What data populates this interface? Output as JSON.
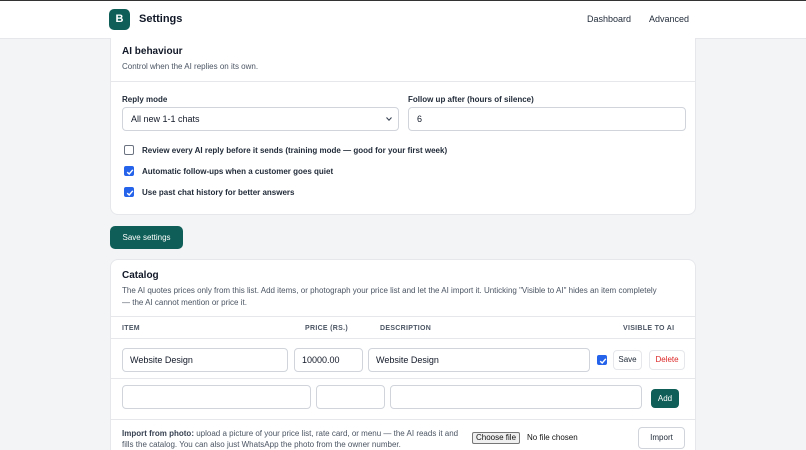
{
  "header": {
    "logo_letter": "B",
    "title": "Settings",
    "nav": {
      "dashboard": "Dashboard",
      "advanced": "Advanced"
    }
  },
  "ai_behaviour": {
    "title": "AI behaviour",
    "subtitle": "Control when the AI replies on its own.",
    "reply_mode": {
      "label": "Reply mode",
      "value": "All new 1-1 chats"
    },
    "follow_up": {
      "label": "Follow up after (hours of silence)",
      "value": "6"
    },
    "options": [
      {
        "label": "Review every AI reply before it sends (training mode — good for your first week)",
        "checked": false
      },
      {
        "label": "Automatic follow-ups when a customer goes quiet",
        "checked": true
      },
      {
        "label": "Use past chat history for better answers",
        "checked": true
      }
    ]
  },
  "save_settings_label": "Save settings",
  "catalog": {
    "title": "Catalog",
    "description": "The AI quotes prices only from this list. Add items, or photograph your price list and let the AI import it. Unticking \"Visible to AI\" hides an item completely — the AI cannot mention or price it.",
    "columns": {
      "item": "ITEM",
      "price": "PRICE (RS.)",
      "description": "DESCRIPTION",
      "visible": "VISIBLE TO AI"
    },
    "rows": [
      {
        "item": "Website Design",
        "price": "10000.00",
        "description": "Website Design",
        "visible": true
      }
    ],
    "row_actions": {
      "save": "Save",
      "delete": "Delete"
    },
    "add_label": "Add",
    "import": {
      "lead": "Import from photo:",
      "text": " upload a picture of your price list, rate card, or menu — the AI reads it and fills the catalog. You can also just WhatsApp the photo from the owner number.",
      "file_button": "Choose file",
      "file_status": "No file chosen",
      "button": "Import"
    }
  },
  "colors": {
    "brand": "#0f5e57",
    "checkbox": "#2563eb",
    "danger": "#dc2626"
  }
}
